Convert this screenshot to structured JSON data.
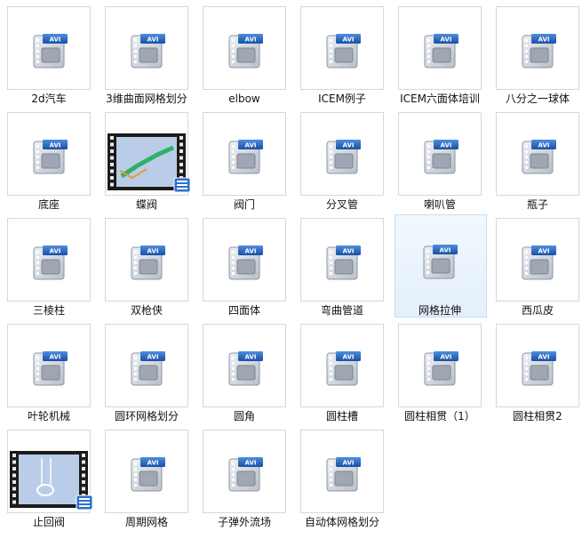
{
  "files": [
    {
      "name": "2d汽车",
      "type": "avi"
    },
    {
      "name": "3维曲面网格划分",
      "type": "avi"
    },
    {
      "name": "elbow",
      "type": "avi"
    },
    {
      "name": "ICEM例子",
      "type": "avi"
    },
    {
      "name": "ICEM六面体培训",
      "type": "avi"
    },
    {
      "name": "八分之一球体",
      "type": "avi"
    },
    {
      "name": "底座",
      "type": "avi"
    },
    {
      "name": "蝶阀",
      "type": "video-thumb"
    },
    {
      "name": "阀门",
      "type": "avi"
    },
    {
      "name": "分叉管",
      "type": "avi"
    },
    {
      "name": "喇叭管",
      "type": "avi"
    },
    {
      "name": "瓶子",
      "type": "avi"
    },
    {
      "name": "三棱柱",
      "type": "avi"
    },
    {
      "name": "双枪侠",
      "type": "avi"
    },
    {
      "name": "四面体",
      "type": "avi"
    },
    {
      "name": "弯曲管道",
      "type": "avi"
    },
    {
      "name": "网格拉伸",
      "type": "avi",
      "hovered": true
    },
    {
      "name": "西瓜皮",
      "type": "avi"
    },
    {
      "name": "叶轮机械",
      "type": "avi"
    },
    {
      "name": "圆环网格划分",
      "type": "avi"
    },
    {
      "name": "圆角",
      "type": "avi"
    },
    {
      "name": "圆柱槽",
      "type": "avi"
    },
    {
      "name": "圆柱相贯（1）",
      "type": "avi"
    },
    {
      "name": "圆柱相贯2",
      "type": "avi"
    },
    {
      "name": "止回阀",
      "type": "video-thumb"
    },
    {
      "name": "周期网格",
      "type": "avi"
    },
    {
      "name": "子弹外流场",
      "type": "avi"
    },
    {
      "name": "自动体网格划分",
      "type": "avi"
    }
  ],
  "icon_badge_text": "AVI",
  "colors": {
    "badge": "#1f5fb8",
    "doc": "#c9ced6",
    "border": "#d7d7d7",
    "hover": "#c3ddf6"
  }
}
